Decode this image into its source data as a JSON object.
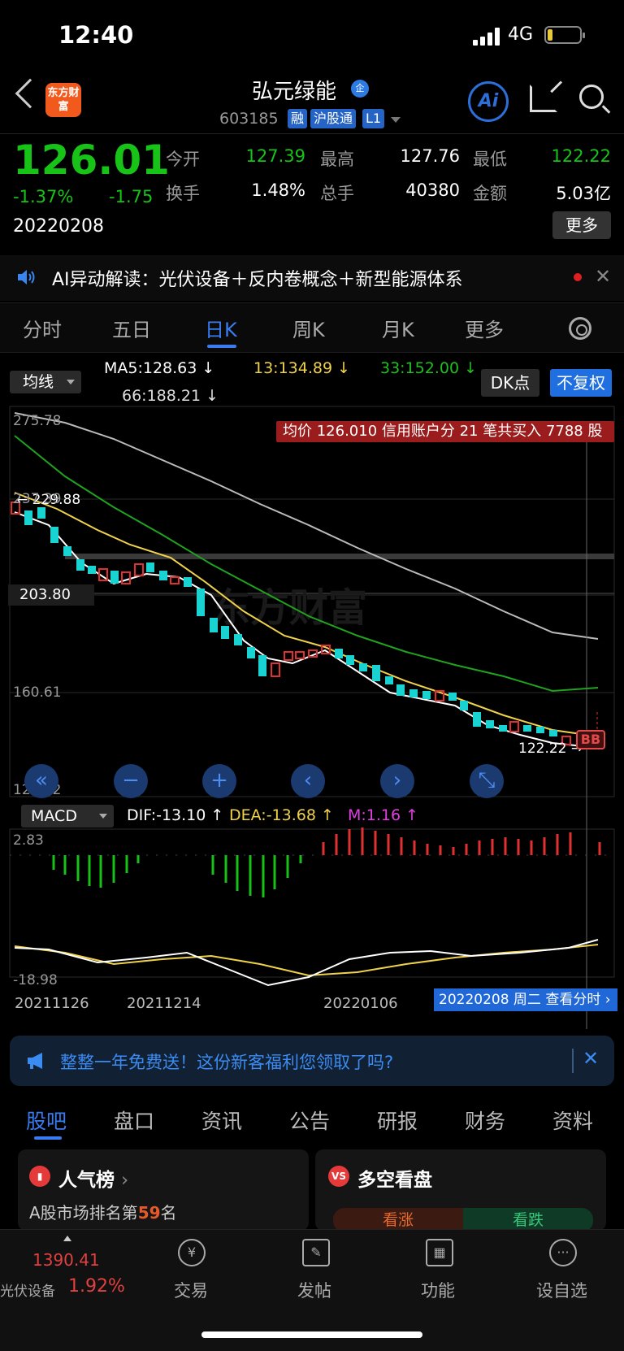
{
  "status": {
    "time": "12:40",
    "network": "4G"
  },
  "header": {
    "logo_text": "东方财富",
    "stock_name": "弘元绿能",
    "qi_badge": "企",
    "stock_code": "603185",
    "tags": [
      "融",
      "沪股通",
      "L1"
    ],
    "ai_label": "Ai"
  },
  "quote": {
    "price": "126.01",
    "change_pct": "-1.37%",
    "change": "-1.75",
    "date": "20220208",
    "open_label": "今开",
    "open": "127.39",
    "high_label": "最高",
    "high": "127.76",
    "low_label": "最低",
    "low": "122.22",
    "turnover_label": "换手",
    "turnover": "1.48%",
    "volume_label": "总手",
    "volume": "40380",
    "amount_label": "金额",
    "amount": "5.03亿",
    "more_label": "更多"
  },
  "ai_bar": {
    "text": "AI异动解读：光伏设备＋反内卷概念＋新型能源体系",
    "close": "✕"
  },
  "period_tabs": [
    "分时",
    "五日",
    "日K",
    "周K",
    "月K",
    "更多"
  ],
  "active_period": "日K",
  "ma_bar": {
    "select": "均线",
    "ma5": "MA5:128.63",
    "ma13": "13:134.89",
    "ma33": "33:152.00",
    "ma66": "66:188.21",
    "dk_label": "DK点",
    "fq_label": "不复权"
  },
  "kline": {
    "banner": "均价 126.010 信用账户分 21 笔共买入 7788 股",
    "y_labels": [
      "275.78",
      "237.39",
      "160.61",
      "122.22"
    ],
    "hi_marker": "229.88",
    "lo_marker": "122.22",
    "price_tag": "203.80",
    "bb_badge": "BB",
    "watermark": "东方财富",
    "controls": [
      "«",
      "−",
      "+",
      "‹",
      "›",
      "⤡"
    ],
    "colors": {
      "up": "#e03030",
      "down": "#19d3d3",
      "ma5": "#ffffff",
      "ma13": "#f0d24a",
      "ma33": "#1fa31f",
      "ma66": "#bbbbbb"
    }
  },
  "macd": {
    "select": "MACD",
    "dif": "DIF:-13.10",
    "dea": "DEA:-13.68",
    "m": "M:1.16",
    "y_top": "2.83",
    "y_bottom": "-18.98"
  },
  "date_axis": [
    "20211126",
    "20211214",
    "20220106"
  ],
  "cursor_date": "20220208 周二 查看分时",
  "promo": {
    "text": "整整一年免费送！这份新客福利您领取了吗?",
    "close": "✕"
  },
  "section_tabs": [
    "股吧",
    "盘口",
    "资讯",
    "公告",
    "研报",
    "财务",
    "资料"
  ],
  "active_section": "股吧",
  "cards": {
    "popular_title": "人气榜",
    "rank_prefix": "A股市场排名第",
    "rank": "59",
    "rank_suffix": "名",
    "duokong_title": "多空看盘",
    "up_label": "看涨",
    "down_label": "看跌"
  },
  "bottom_bar": {
    "sector_value": "1390.41",
    "sector_name": "光伏设备",
    "sector_pct": "1.92%",
    "items": [
      "交易",
      "发帖",
      "功能",
      "设自选"
    ]
  }
}
